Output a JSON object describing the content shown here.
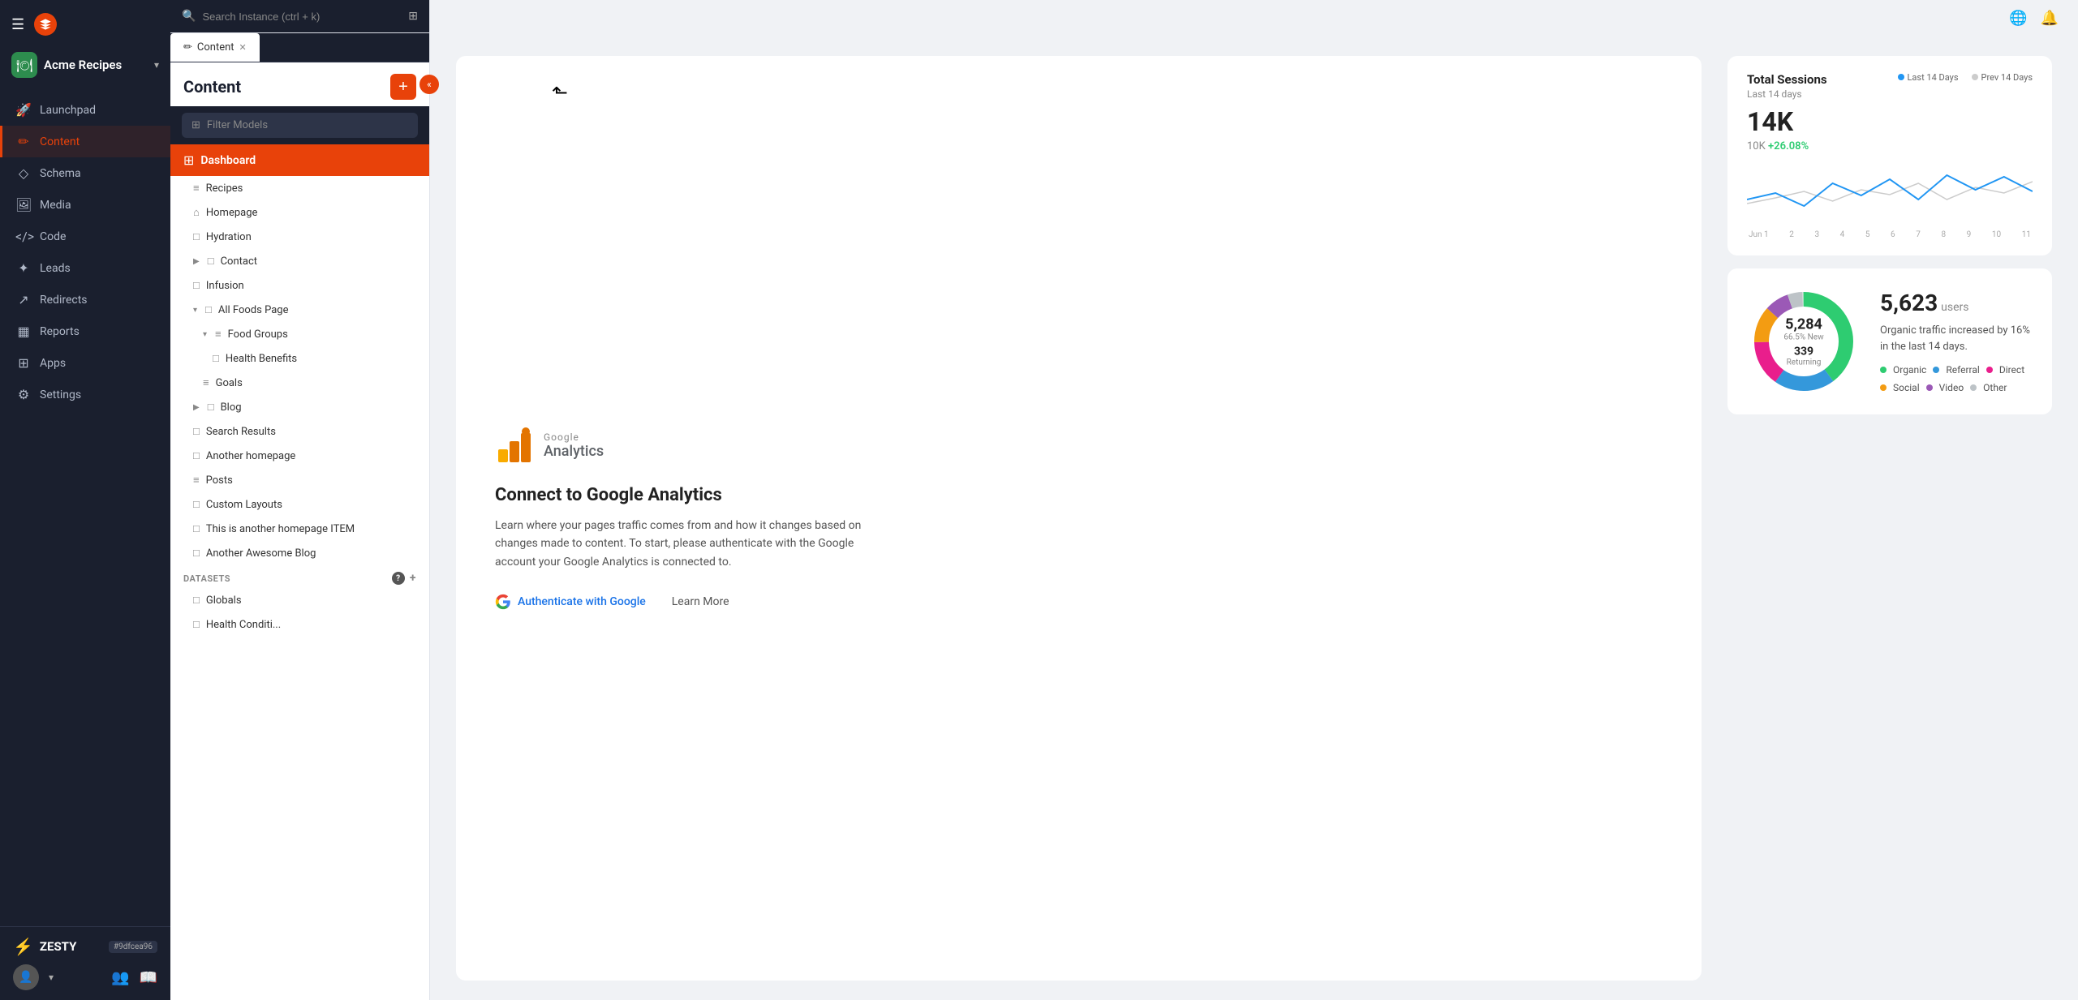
{
  "sidebar": {
    "brand": {
      "name": "Acme Recipes",
      "icon": "🍽"
    },
    "nav_items": [
      {
        "id": "launchpad",
        "label": "Launchpad",
        "icon": "🚀",
        "active": false
      },
      {
        "id": "content",
        "label": "Content",
        "icon": "✏",
        "active": true
      },
      {
        "id": "schema",
        "label": "Schema",
        "icon": "◇",
        "active": false
      },
      {
        "id": "media",
        "label": "Media",
        "icon": "□",
        "active": false
      },
      {
        "id": "code",
        "label": "Code",
        "icon": "<>",
        "active": false
      },
      {
        "id": "leads",
        "label": "Leads",
        "icon": "⋮",
        "active": false
      },
      {
        "id": "redirects",
        "label": "Redirects",
        "icon": "↗",
        "active": false
      },
      {
        "id": "reports",
        "label": "Reports",
        "icon": "▦",
        "active": false
      },
      {
        "id": "apps",
        "label": "Apps",
        "icon": "⊞",
        "active": false
      },
      {
        "id": "settings",
        "label": "Settings",
        "icon": "⚙",
        "active": false
      }
    ],
    "hash": "#9dfcea96",
    "zesty_label": "ZESTY"
  },
  "content_panel": {
    "search_placeholder": "Search Instance (ctrl + k)",
    "title": "Content",
    "filter_placeholder": "Filter Models",
    "tab_label": "Content",
    "dashboard_label": "Dashboard",
    "nav_items": [
      {
        "id": "recipes",
        "label": "Recipes",
        "icon": "≡",
        "indent": 1,
        "chevron": false
      },
      {
        "id": "homepage",
        "label": "Homepage",
        "icon": "⌂",
        "indent": 1,
        "chevron": false
      },
      {
        "id": "hydration",
        "label": "Hydration",
        "icon": "□",
        "indent": 1,
        "chevron": false
      },
      {
        "id": "contact",
        "label": "Contact",
        "icon": "□",
        "indent": 1,
        "chevron": true,
        "chevron_dir": "right"
      },
      {
        "id": "infusion",
        "label": "Infusion",
        "icon": "□",
        "indent": 1,
        "chevron": false
      },
      {
        "id": "all-foods",
        "label": "All Foods Page",
        "icon": "□",
        "indent": 1,
        "chevron": true,
        "chevron_dir": "down"
      },
      {
        "id": "food-groups",
        "label": "Food Groups",
        "icon": "≡",
        "indent": 2,
        "chevron": true,
        "chevron_dir": "down"
      },
      {
        "id": "health-benefits",
        "label": "Health Benefits",
        "icon": "□",
        "indent": 3,
        "chevron": false
      },
      {
        "id": "goals",
        "label": "Goals",
        "icon": "≡",
        "indent": 2,
        "chevron": false
      },
      {
        "id": "blog",
        "label": "Blog",
        "icon": "□",
        "indent": 1,
        "chevron": true,
        "chevron_dir": "right"
      },
      {
        "id": "search-results",
        "label": "Search Results",
        "icon": "□",
        "indent": 1,
        "chevron": false
      },
      {
        "id": "another-homepage",
        "label": "Another homepage",
        "icon": "□",
        "indent": 1,
        "chevron": false
      },
      {
        "id": "posts",
        "label": "Posts",
        "icon": "≡",
        "indent": 1,
        "chevron": false
      },
      {
        "id": "custom-layouts",
        "label": "Custom Layouts",
        "icon": "□",
        "indent": 1,
        "chevron": false
      },
      {
        "id": "another-homepage-item",
        "label": "This is another homepage ITEM",
        "icon": "□",
        "indent": 1,
        "chevron": false
      },
      {
        "id": "another-awesome-blog",
        "label": "Another Awesome Blog",
        "icon": "□",
        "indent": 1,
        "chevron": false
      }
    ],
    "datasets_label": "DATASETS",
    "dataset_items": [
      {
        "id": "globals",
        "label": "Globals",
        "icon": "□",
        "indent": 1
      },
      {
        "id": "health-conditions",
        "label": "Health Conditi...",
        "icon": "□",
        "indent": 1
      }
    ]
  },
  "main": {
    "google_analytics": {
      "title": "Connect to Google Analytics",
      "description": "Learn where your pages traffic comes from and how it changes based on changes made to content. To start, please authenticate with the Google account your Google Analytics is connected to.",
      "auth_button": "Authenticate with Google",
      "learn_more": "Learn More"
    },
    "total_sessions": {
      "title": "Total Sessions",
      "subtitle": "Last 14 days",
      "legend_current": "Last 14 Days",
      "legend_prev": "Prev 14 Days",
      "value": "14K",
      "baseline": "10K",
      "change": "+26.08%",
      "chart_labels": [
        "Jun 1",
        "2",
        "3",
        "4",
        "5",
        "6",
        "7",
        "8",
        "9",
        "10",
        "11"
      ]
    },
    "users": {
      "total": "5,623",
      "label": "users",
      "description": "Organic traffic increased by 16% in the last 14 days.",
      "new_count": "5,284",
      "new_label": "66.5% New",
      "returning_count": "339",
      "returning_label": "Returning",
      "legend": [
        {
          "label": "Organic",
          "color": "#2ecc71"
        },
        {
          "label": "Referral",
          "color": "#3498db"
        },
        {
          "label": "Direct",
          "color": "#e91e8c"
        },
        {
          "label": "Social",
          "color": "#f39c12"
        },
        {
          "label": "Video",
          "color": "#9b59b6"
        },
        {
          "label": "Other",
          "color": "#bdc3c7"
        }
      ]
    }
  }
}
